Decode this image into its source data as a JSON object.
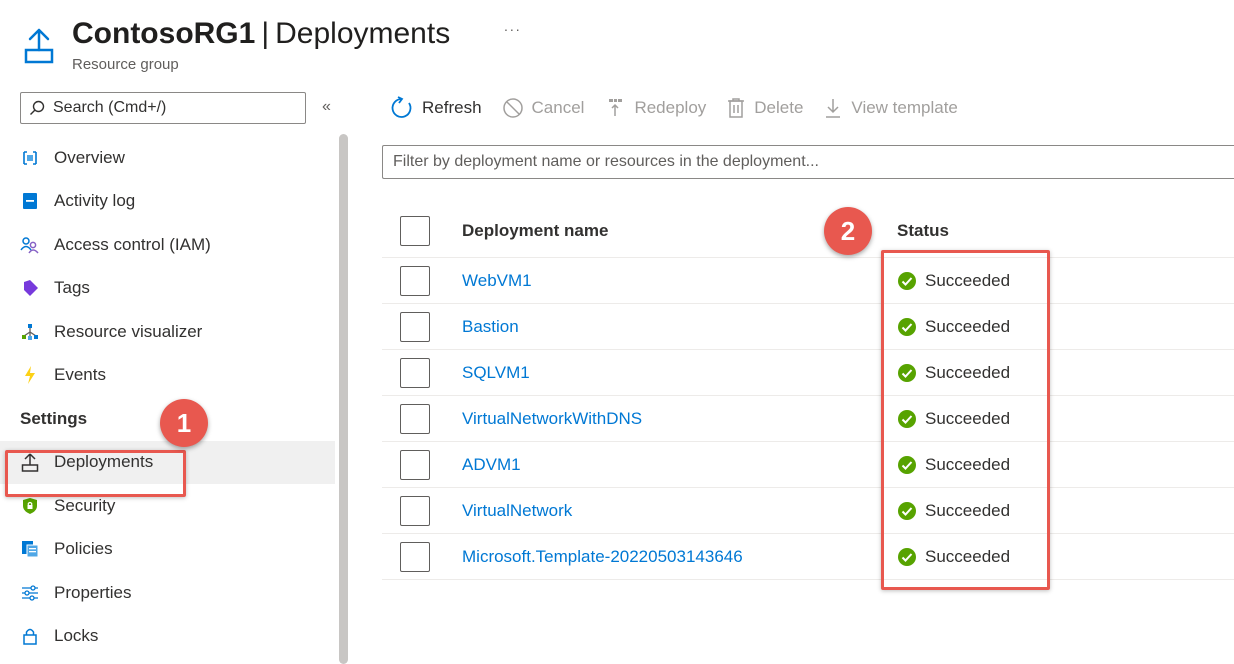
{
  "header": {
    "title_bold": "ContosoRG1",
    "title_sep": "|",
    "title_rest": "Deployments",
    "subtitle": "Resource group",
    "more": "..."
  },
  "search": {
    "placeholder": "Search (Cmd+/)",
    "collapse": "«"
  },
  "nav": {
    "items_top": [
      {
        "label": "Overview",
        "icon": "overview-icon"
      },
      {
        "label": "Activity log",
        "icon": "activity-log-icon"
      },
      {
        "label": "Access control (IAM)",
        "icon": "people-icon"
      },
      {
        "label": "Tags",
        "icon": "tag-icon"
      },
      {
        "label": "Resource visualizer",
        "icon": "visualizer-icon"
      },
      {
        "label": "Events",
        "icon": "lightning-icon"
      }
    ],
    "section": "Settings",
    "items_settings": [
      {
        "label": "Deployments",
        "icon": "deploy-icon"
      },
      {
        "label": "Security",
        "icon": "shield-icon"
      },
      {
        "label": "Policies",
        "icon": "policy-icon"
      },
      {
        "label": "Properties",
        "icon": "sliders-icon"
      },
      {
        "label": "Locks",
        "icon": "lock-icon"
      }
    ]
  },
  "toolbar": {
    "refresh": "Refresh",
    "cancel": "Cancel",
    "redeploy": "Redeploy",
    "delete": "Delete",
    "view_template": "View template"
  },
  "filter": {
    "placeholder": "Filter by deployment name or resources in the deployment..."
  },
  "table": {
    "headers": {
      "name": "Deployment name",
      "status": "Status"
    },
    "rows": [
      {
        "name": "WebVM1",
        "status": "Succeeded"
      },
      {
        "name": "Bastion",
        "status": "Succeeded"
      },
      {
        "name": "SQLVM1",
        "status": "Succeeded"
      },
      {
        "name": "VirtualNetworkWithDNS",
        "status": "Succeeded"
      },
      {
        "name": "ADVM1",
        "status": "Succeeded"
      },
      {
        "name": "VirtualNetwork",
        "status": "Succeeded"
      },
      {
        "name": "Microsoft.Template-20220503143646",
        "status": "Succeeded"
      }
    ]
  },
  "annotations": {
    "badge1": "1",
    "badge2": "2"
  },
  "colors": {
    "accent": "#0078d4",
    "success": "#57a300",
    "highlight": "#e8584f"
  }
}
